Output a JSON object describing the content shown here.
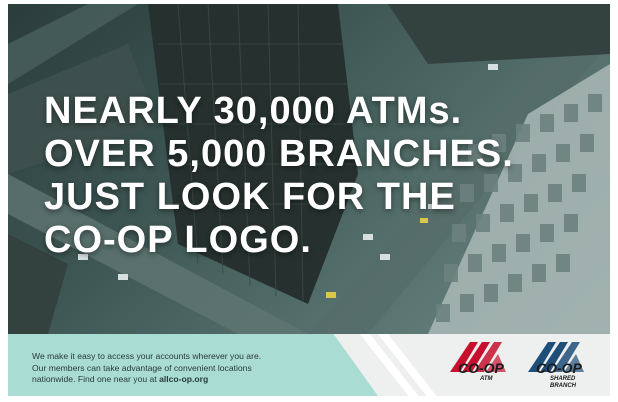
{
  "headline": {
    "lines": [
      "NEARLY 30,000 ATMs.",
      "OVER 5,000 BRANCHES.",
      "JUST LOOK FOR THE",
      "CO-OP LOGO."
    ]
  },
  "footer": {
    "lines": [
      "We make it easy to access your accounts wherever you are.",
      "Our members can take advantage of convenient locations",
      "nationwide. Find one near you at"
    ],
    "url": "allco-op.org"
  },
  "logos": [
    {
      "icon": "co-op-atm-logo",
      "name": "CO-OP",
      "sub": "ATM",
      "color": "#c8102e"
    },
    {
      "icon": "co-op-shared-branch-logo",
      "name": "CO-OP",
      "sub": "SHARED BRANCH",
      "color": "#1f4e79"
    }
  ],
  "colors": {
    "footer_band": "#a9dcd3",
    "footer_bg": "#eef0f0",
    "photo_tint": "#3c5552",
    "headline": "#ffffff"
  }
}
